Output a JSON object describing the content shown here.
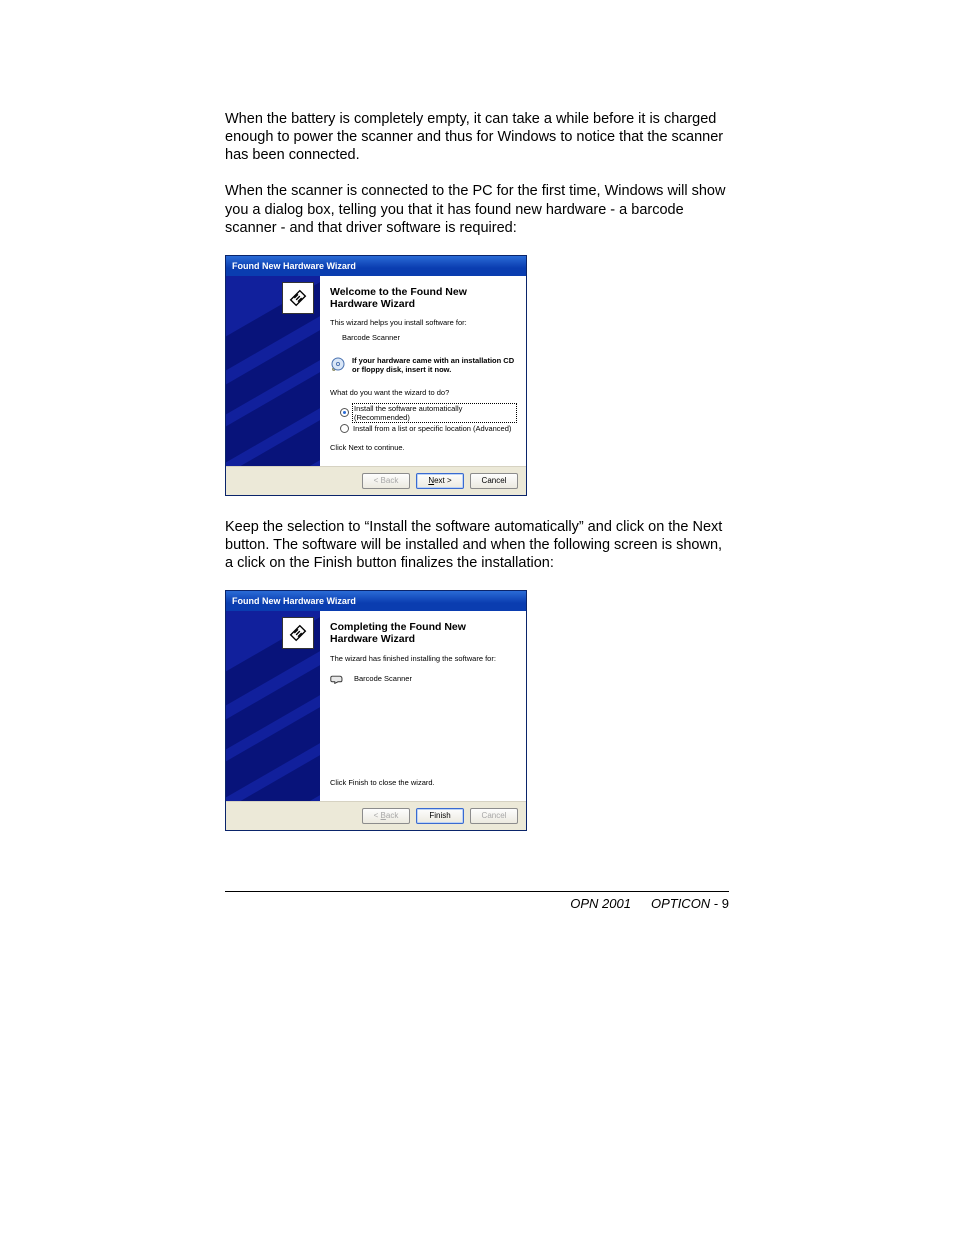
{
  "paragraphs": {
    "p1": "When the battery is completely empty, it can take a while before it is charged enough to power the scanner and thus for Windows to notice that the scanner has been connected.",
    "p2": "When the scanner is connected to the PC for the first time, Windows will show you a dialog box, telling you that it has found new hardware - a barcode scanner - and that driver software is required:",
    "p3": "Keep the selection to “Install the software automatically” and click on the Next button. The software will be installed and when the following screen is shown, a click on the Finish button finalizes the installation:"
  },
  "wizard1": {
    "title": "Found New Hardware Wizard",
    "heading": "Welcome to the Found New Hardware Wizard",
    "intro": "This wizard helps you install software for:",
    "device": "Barcode Scanner",
    "hint": "If your hardware came with an installation CD or floppy disk, insert it now.",
    "question": "What do you want the wizard to do?",
    "option1": "Install the software automatically (Recommended)",
    "option2": "Install from a list or specific location (Advanced)",
    "continue": "Click Next to continue.",
    "buttons": {
      "back": "< Back",
      "next_prefix": "N",
      "next_rest": "ext >",
      "cancel": "Cancel"
    }
  },
  "wizard2": {
    "title": "Found New Hardware Wizard",
    "heading": "Completing the Found New Hardware Wizard",
    "intro": "The wizard has finished installing the software for:",
    "device": "Barcode Scanner",
    "closing": "Click Finish to close the wizard.",
    "buttons": {
      "back_prefix": "< ",
      "back_u": "B",
      "back_rest": "ack",
      "finish": "Finish",
      "cancel": "Cancel"
    }
  },
  "footer": {
    "model": "OPN 2001",
    "brand": "OPTICON",
    "page": "9"
  }
}
